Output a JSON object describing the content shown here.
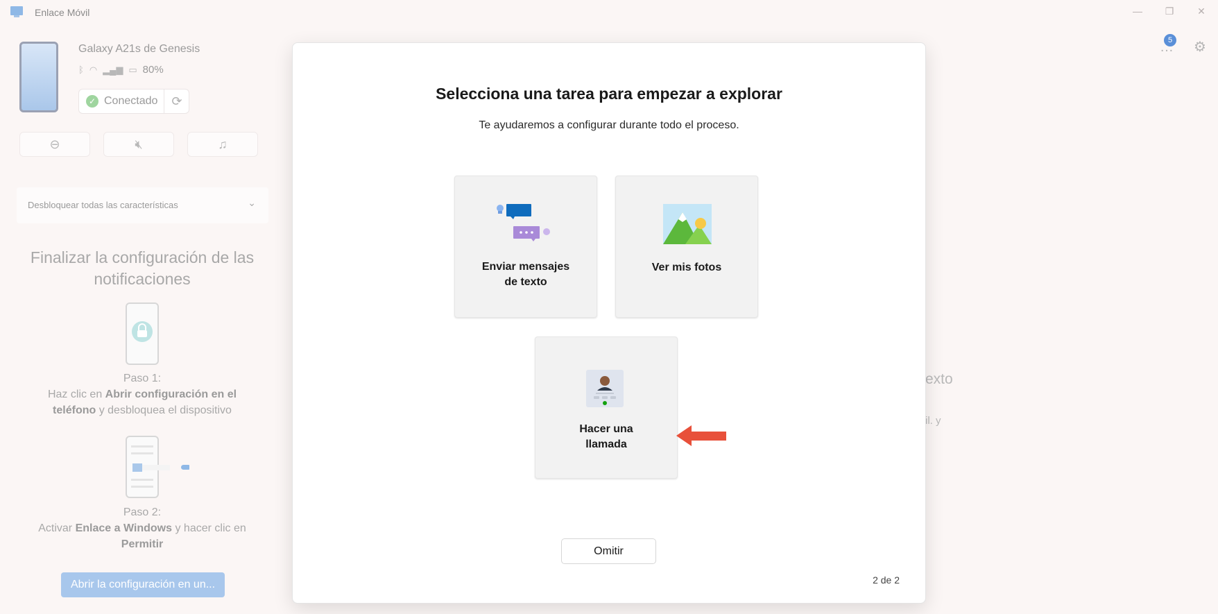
{
  "window": {
    "title": "Enlace Móvil"
  },
  "device": {
    "name": "Galaxy A21s de Genesis",
    "battery": "80%",
    "status": "Conectado"
  },
  "unlock": {
    "label": "Desbloquear todas las características"
  },
  "setup": {
    "title": "Finalizar la configuración de las notificaciones",
    "step1_heading": "Paso 1:",
    "step1_pre": "Haz clic en ",
    "step1_bold": "Abrir configuración en el teléfono",
    "step1_post": " y desbloquea el dispositivo",
    "step2_heading": "Paso 2:",
    "step2_pre": "Activar ",
    "step2_bold": "Enlace a Windows",
    "step2_mid": " y hacer clic en ",
    "step2_bold2": "Permitir",
    "button": "Abrir la configuración en un..."
  },
  "toolbar": {
    "notification_count": "5"
  },
  "background_right": {
    "text1": "exto",
    "text2": "il. y"
  },
  "modal": {
    "title": "Selecciona una tarea para empezar a explorar",
    "subtitle": "Te ayudaremos a configurar durante todo el proceso.",
    "tasks": [
      {
        "label_line1": "Enviar mensajes",
        "label_line2": "de texto",
        "icon": "messages-icon"
      },
      {
        "label_line1": "Ver mis fotos",
        "label_line2": "",
        "icon": "photos-icon"
      },
      {
        "label_line1": "Hacer una",
        "label_line2": "llamada",
        "icon": "call-icon"
      }
    ],
    "skip": "Omitir",
    "page": "2 de 2"
  },
  "colors": {
    "accent": "#0f6cbd",
    "arrow": "#e8503a"
  }
}
